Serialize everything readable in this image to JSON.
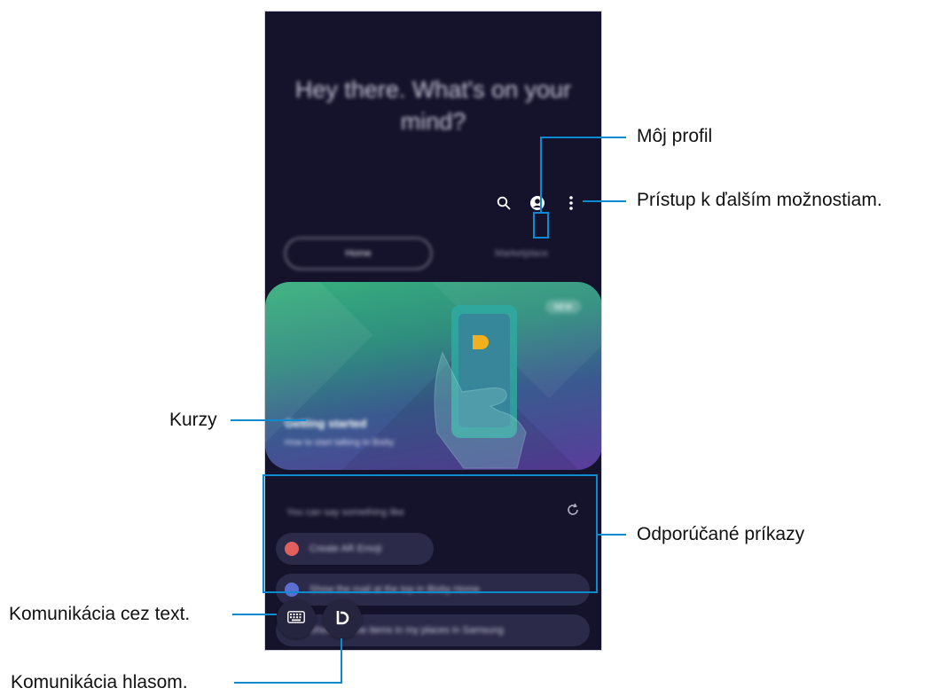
{
  "screen": {
    "greeting": "Hey there. What's on your mind?",
    "tabs": [
      "Home",
      "Marketplace"
    ],
    "card": {
      "badge": "NEW",
      "title": "Getting started",
      "subtitle": "How to start talking to Bixby"
    },
    "suggestions": {
      "title": "You can say something like",
      "items": [
        "Create AR Emoji",
        "Show the mail at the top in Bixby Home",
        "Show me the items in my places in Samsung"
      ]
    },
    "icons": {
      "search": "search-icon",
      "profile": "profile-icon",
      "more": "more-options-icon",
      "keyboard": "keyboard-icon",
      "bixby": "bixby-icon",
      "refresh": "refresh-icon"
    }
  },
  "callouts": {
    "profile": "Môj profil",
    "more_options": "Prístup k ďalším možnostiam.",
    "tutorials": "Kurzy",
    "suggested": "Odporúčané príkazy",
    "text_comm": "Komunikácia cez text.",
    "voice_comm": "Komunikácia hlasom."
  },
  "colors": {
    "screen_bg": "#14132b",
    "callout_line": "#0e8ad0",
    "bixby_accent": "#f2b01e"
  }
}
